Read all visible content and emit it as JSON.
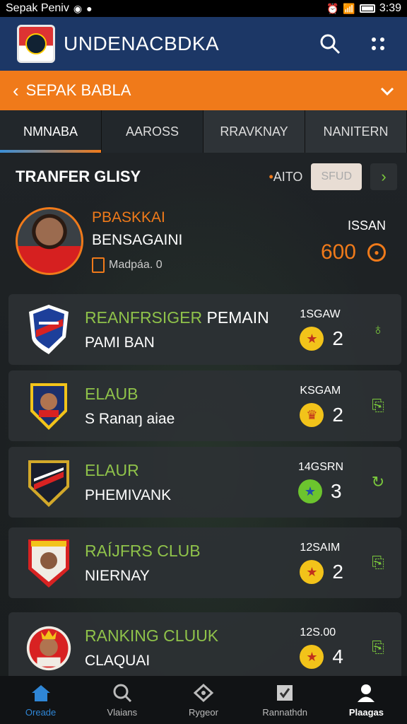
{
  "status_bar": {
    "left_text": "Sepak Peniv",
    "time": "3:39"
  },
  "app_bar": {
    "title": "UNDENACBDKA",
    "icons": [
      "logo-crest-icon",
      "search-icon",
      "more-dots-icon"
    ]
  },
  "league": {
    "name": "SEPAK BABLA"
  },
  "tabs": [
    {
      "label": "NMNABA",
      "active": true
    },
    {
      "label": "AAROSS",
      "active": false
    },
    {
      "label": "RRAVKNAY",
      "active": false
    },
    {
      "label": "NANITERN",
      "active": false
    }
  ],
  "section": {
    "title": "TRANFER GLISY",
    "auto_label": "AITO",
    "pill_label": "SFUD"
  },
  "featured": {
    "name_top": "PBASKKAI",
    "name_bottom": "BENSAGAINI",
    "meta": "Madpáa. 0",
    "label": "ISSAN",
    "value": "600"
  },
  "rows": [
    {
      "title_green": "REANFRSIGER",
      "title_white": " PEMAIN",
      "subtitle": "PAMI BAN",
      "label": "1SGAW",
      "count": "2",
      "badge_color": "#f2c31a"
    },
    {
      "title_green": "ELAUB",
      "title_white": "",
      "subtitle": "S Ranaŋ aiae",
      "label": "KSGAM",
      "count": "2",
      "badge_color": "#f2c31a"
    },
    {
      "title_green": "ELAUR",
      "title_white": "",
      "subtitle": "PHEMIVANK",
      "label": "14GSRN",
      "count": "3",
      "badge_color": "#6cc42e"
    },
    {
      "title_green": "RAÍJFRS CLUB",
      "title_white": "",
      "subtitle": "NIERNAY",
      "label": "12SAIM",
      "count": "2",
      "badge_color": "#f2c31a"
    },
    {
      "title_green": "RANKING CLUUK",
      "title_white": "",
      "subtitle": "CLAQUAI",
      "label": "12S.00",
      "count": "4",
      "badge_color": "#f2c31a"
    }
  ],
  "bottom_nav": [
    {
      "label": "Oreade",
      "icon": "home-icon"
    },
    {
      "label": "Vlaians",
      "icon": "search-icon"
    },
    {
      "label": "Rygeor",
      "icon": "tag-icon"
    },
    {
      "label": "Rannathdn",
      "icon": "checkbox-icon"
    },
    {
      "label": "Plaagas",
      "icon": "profile-icon"
    }
  ]
}
